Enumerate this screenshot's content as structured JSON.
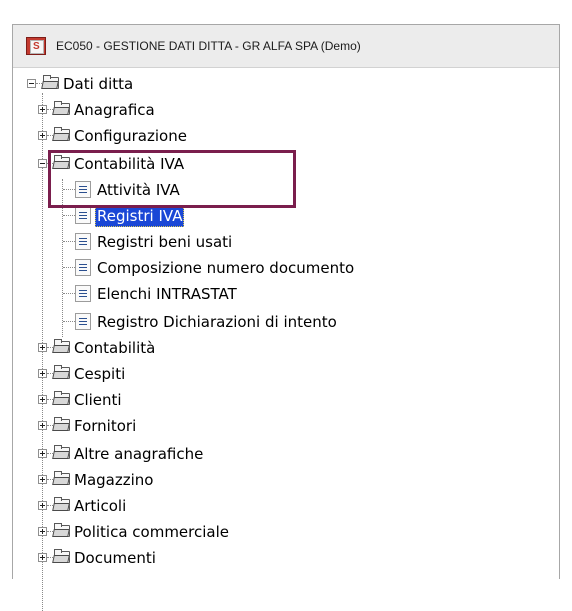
{
  "window": {
    "title": "EC050 - GESTIONE DATI DITTA - GR ALFA SPA  (Demo)",
    "icon": "app-icon"
  },
  "tree": {
    "root": {
      "label": "Dati ditta",
      "expanded": true
    },
    "items": [
      {
        "label": "Anagrafica",
        "type": "folder",
        "expanded": false
      },
      {
        "label": "Configurazione",
        "type": "folder",
        "expanded": false
      },
      {
        "label": "Contabilità IVA",
        "type": "folder",
        "expanded": true
      },
      {
        "label": "Attività IVA",
        "type": "document",
        "child_of": "Contabilità IVA"
      },
      {
        "label": "Registri IVA",
        "type": "document",
        "child_of": "Contabilità IVA",
        "selected": true
      },
      {
        "label": "Registri beni usati",
        "type": "document",
        "child_of": "Contabilità IVA"
      },
      {
        "label": "Composizione numero documento",
        "type": "document",
        "child_of": "Contabilità IVA"
      },
      {
        "label": "Elenchi INTRASTAT",
        "type": "document",
        "child_of": "Contabilità IVA"
      },
      {
        "label": "Registro Dichiarazioni di intento",
        "type": "document",
        "child_of": "Contabilità IVA"
      },
      {
        "label": "Contabilità",
        "type": "folder",
        "expanded": false
      },
      {
        "label": "Cespiti",
        "type": "folder",
        "expanded": false
      },
      {
        "label": "Clienti",
        "type": "folder",
        "expanded": false
      },
      {
        "label": "Fornitori",
        "type": "folder",
        "expanded": false
      },
      {
        "label": "Altre anagrafiche",
        "type": "folder",
        "expanded": false
      },
      {
        "label": "Magazzino",
        "type": "folder",
        "expanded": false
      },
      {
        "label": "Articoli",
        "type": "folder",
        "expanded": false
      },
      {
        "label": "Politica commerciale",
        "type": "folder",
        "expanded": false
      },
      {
        "label": "Documenti",
        "type": "folder",
        "expanded": false
      }
    ]
  },
  "colors": {
    "selection": "#1a47d6",
    "highlight_box": "#7a1e4d",
    "titlebar": "#ececec"
  }
}
